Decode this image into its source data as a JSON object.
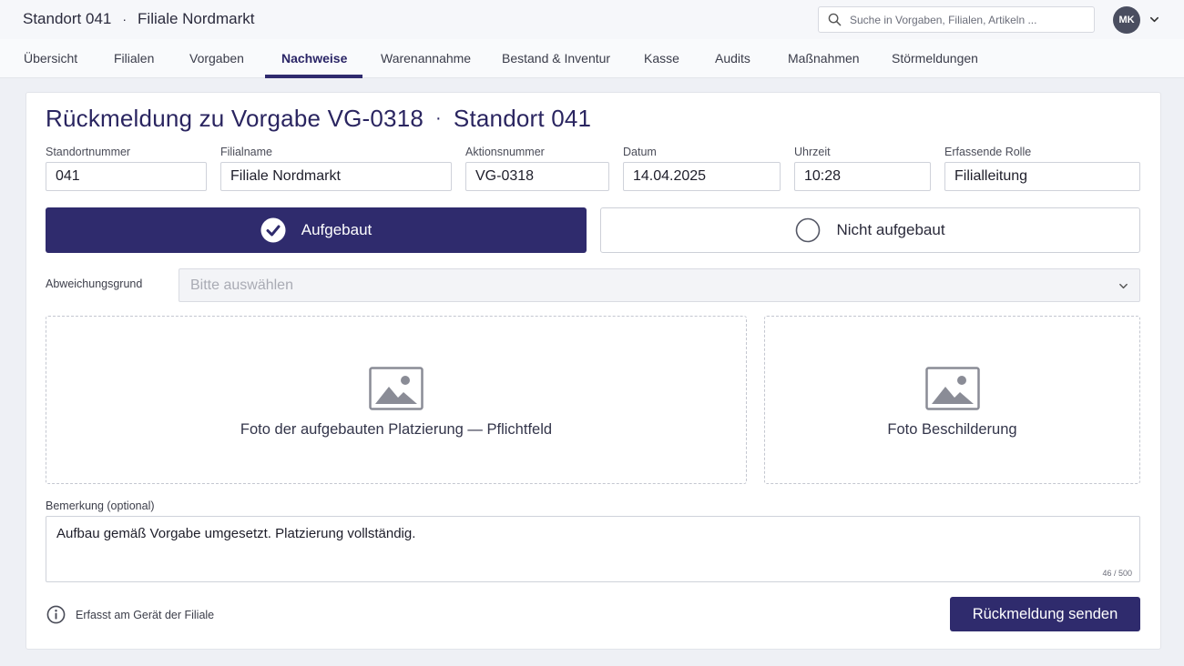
{
  "header": {
    "location": "Standort 041",
    "branch": "Filiale Nordmarkt",
    "separator": "·",
    "search_placeholder": "Suche in Vorgaben, Filialen, Artikeln ...",
    "user_initials": "MK"
  },
  "nav": {
    "tabs": [
      {
        "label": "Übersicht"
      },
      {
        "label": "Filialen"
      },
      {
        "label": "Vorgaben"
      },
      {
        "label": "Nachweise",
        "active": true
      },
      {
        "label": "Warenannahme"
      },
      {
        "label": "Bestand & Inventur"
      },
      {
        "label": "Kasse"
      },
      {
        "label": "Audits"
      },
      {
        "label": "Maßnahmen"
      },
      {
        "label": "Störmeldungen"
      }
    ]
  },
  "page": {
    "title_main": "Rückmeldung zu Vorgabe VG-0318",
    "title_sep": "·",
    "title_location": "Standort 041"
  },
  "fields": {
    "standortnummer": {
      "label": "Standortnummer",
      "value": "041"
    },
    "filialname": {
      "label": "Filialname",
      "value": "Filiale Nordmarkt"
    },
    "aktionsnummer": {
      "label": "Aktionsnummer",
      "value": "VG-0318"
    },
    "datum": {
      "label": "Datum",
      "value": "14.04.2025"
    },
    "uhrzeit": {
      "label": "Uhrzeit",
      "value": "10:28"
    },
    "rolle": {
      "label": "Erfassende Rolle",
      "value": "Filialleitung"
    }
  },
  "status": {
    "built_label": "Aufgebaut",
    "not_built_label": "Nicht aufgebaut",
    "selected": "Aufgebaut"
  },
  "deviation": {
    "label": "Abweichungsgrund",
    "placeholder": "Bitte auswählen"
  },
  "photos": {
    "placement_caption": "Foto der aufgebauten Platzierung — Pflichtfeld",
    "signage_caption": "Foto Beschilderung"
  },
  "remark": {
    "label": "Bemerkung (optional)",
    "value": "Aufbau gemäß Vorgabe umgesetzt. Platzierung vollständig.",
    "counter": "46 / 500"
  },
  "footer": {
    "info_text": "Erfasst am Gerät der Filiale",
    "submit_label": "Rückmeldung senden"
  },
  "colors": {
    "primary": "#2f2b6d",
    "title": "#2a2560",
    "background": "#eef0f5"
  }
}
